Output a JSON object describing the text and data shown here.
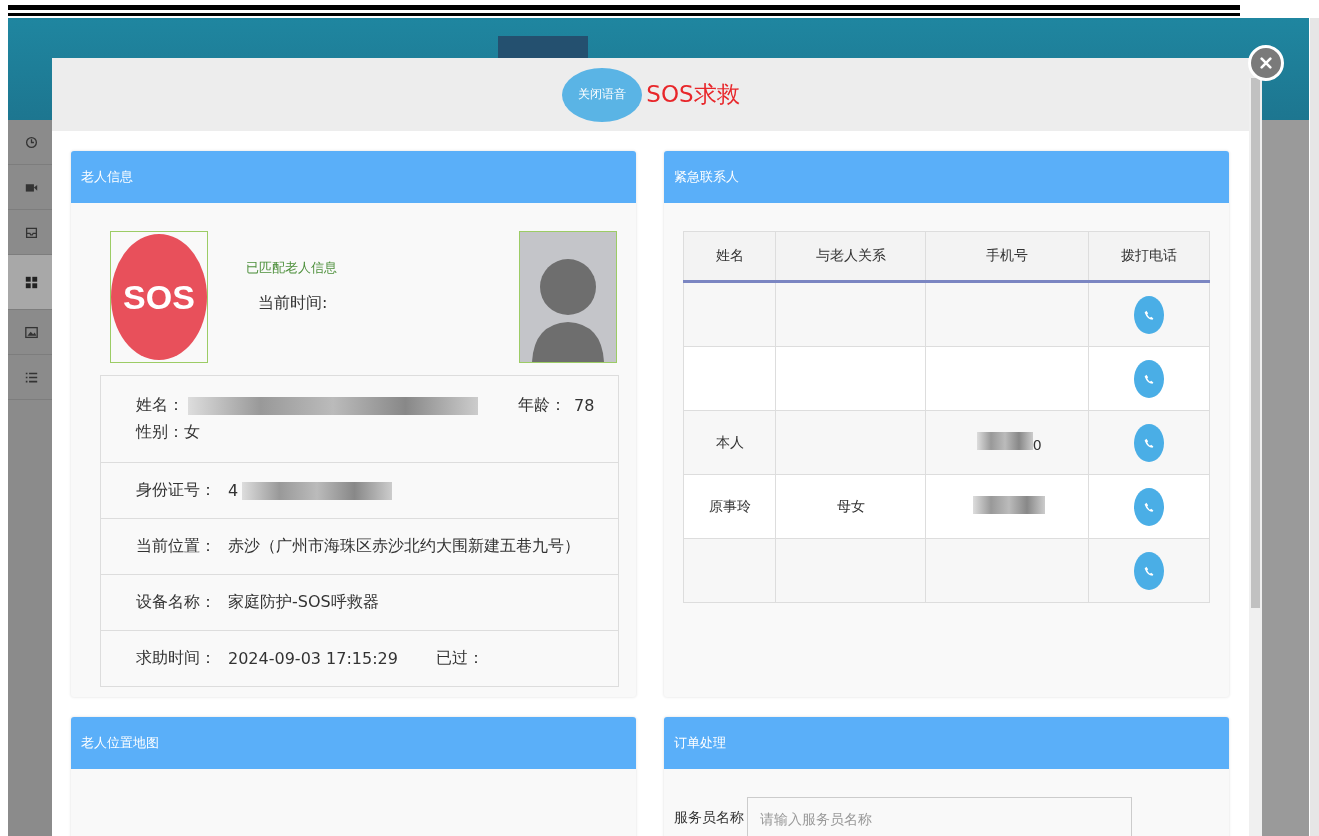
{
  "backdrop": {
    "sidebar_icons": [
      {
        "kind": "clock"
      },
      {
        "kind": "video"
      },
      {
        "kind": "inbox"
      },
      {
        "kind": "grid"
      },
      {
        "kind": "image"
      },
      {
        "kind": "list"
      }
    ]
  },
  "modal": {
    "voice_button": "关闭语音",
    "title": "SOS求救",
    "elder_info": {
      "title": "老人信息",
      "sos_badge": "SOS",
      "match_status": "已匹配老人信息",
      "current_time_label": "当前时间:",
      "rows": [
        {
          "kind": "person",
          "name_label": "姓名：",
          "name_masked": true,
          "age_label": "年龄：",
          "age": "78",
          "gender_label": "性别：",
          "gender": "女"
        },
        {
          "kind": "masked",
          "label": "身份证号：",
          "value": "4"
        },
        {
          "kind": "plain",
          "label": "当前位置：",
          "value": "赤沙（广州市海珠区赤沙北约大围新建五巷九号）"
        },
        {
          "kind": "plain",
          "label": "设备名称：",
          "value": "家庭防护-SOS呼救器"
        },
        {
          "kind": "time",
          "label": "求助时间：",
          "value": "2024-09-03 17:15:29",
          "elapsed_label": "已过："
        }
      ]
    },
    "contacts": {
      "title": "紧急联系人",
      "columns": [
        "姓名",
        "与老人关系",
        "手机号",
        "拨打电话"
      ],
      "rows": [
        {},
        {},
        {
          "name": "本人",
          "phone": "0",
          "phone_masked": true
        },
        {
          "name": "原事玲",
          "relation": "母女",
          "phone_masked": true
        },
        {}
      ]
    },
    "map": {
      "title": "老人位置地图"
    },
    "order": {
      "title": "订单处理",
      "field_label": "服务员名称",
      "placeholder": "请输入服务员名称"
    }
  }
}
